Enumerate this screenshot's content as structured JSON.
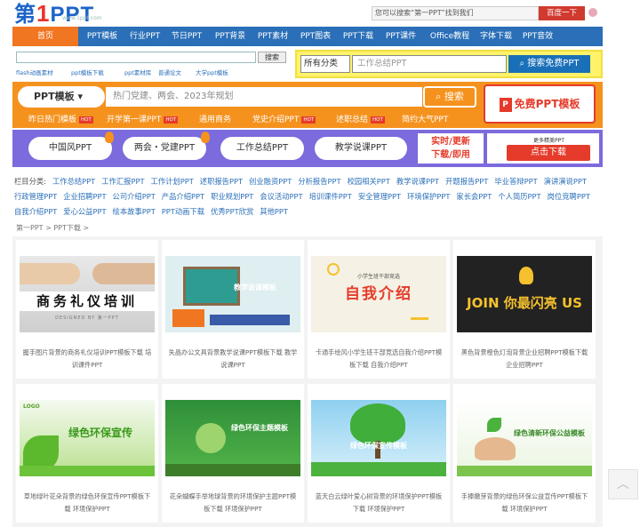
{
  "header": {
    "logo_text_a": "第",
    "logo_text_one": "1",
    "logo_text_b": "PPT",
    "logo_url": "www.1ppt.com",
    "search_placeholder": "您可以搜索“第一PPT”找到我们",
    "search_button": "百度一下"
  },
  "nav": {
    "items": [
      "首页",
      "PPT模板",
      "行业PPT",
      "节日PPT",
      "PPT背景",
      "PPT素材",
      "PPT图表",
      "PPT下载",
      "PPT课件",
      "Office教程",
      "字体下载",
      "PPT音效"
    ]
  },
  "strip": {
    "left_button": "搜索",
    "tags": [
      "flash动画素材",
      "ppt模板下载",
      "ppt素材库",
      "普通论文",
      "大学ppt模板"
    ],
    "category": "所有分类",
    "placeholder": "工作总结PPT",
    "button": "搜索免费PPT"
  },
  "orange": {
    "category": "PPT模板",
    "placeholder": "热门党建、两会、2023年规划",
    "search_button": "搜索",
    "free_button": "免费PPT模板",
    "free_icon": "P",
    "hot_label": "HOT",
    "links": [
      {
        "label": "昨日热门模板",
        "hot": true
      },
      {
        "label": "开学第一课PPT",
        "hot": true
      },
      {
        "label": "通用商务",
        "hot": false
      },
      {
        "label": "党史介绍PPT",
        "hot": true
      },
      {
        "label": "述职总结",
        "hot": true
      },
      {
        "label": "简约大气PPT",
        "hot": false
      }
    ]
  },
  "banner": {
    "pills": [
      "中国风PPT",
      "两会・党建PPT",
      "工作总结PPT",
      "教学说课PPT"
    ],
    "real_line1": "实时/更新",
    "real_line2": "下载/即用",
    "more": "更多精美PPT",
    "click": "点击下载"
  },
  "categories": {
    "label": "栏目分类:",
    "rows": [
      [
        "工作总结PPT",
        "工作汇报PPT",
        "工作计划PPT",
        "述职报告PPT",
        "创业融资PPT",
        "分析报告PPT",
        "校园相关PPT",
        "教学说课PPT",
        "开题报告PPT",
        "毕业答辩PPT",
        "演讲演说PPT"
      ],
      [
        "行政管理PPT",
        "企业招聘PPT",
        "公司介绍PPT",
        "产品介绍PPT",
        "职业规划PPT",
        "会议活动PPT",
        "培训课件PPT",
        "安全管理PPT",
        "环境保护PPT",
        "家长会PPT",
        "个人简历PPT",
        "岗位竞聘PPT"
      ],
      [
        "自我介绍PPT",
        "爱心公益PPT",
        "绘本故事PPT",
        "PPT动画下载",
        "优秀PPT欣赏",
        "其他PPT"
      ]
    ]
  },
  "breadcrumb": "第一PPT > PPT下载 >",
  "cards": [
    {
      "thumb_title": "商务礼仪培训",
      "thumb_sub": "DESIGNED BY 第一PPT",
      "caption": "握手图片背景的商务礼仪培训PPT模板下载 培训课件PPT"
    },
    {
      "thumb_title": "教学说课模板",
      "thumb_sub": "",
      "caption": "失晶办公文具背景教学说课PPT模板下载 教学说课PPT"
    },
    {
      "thumb_title": "自我介绍",
      "thumb_sub": "小学生班干部竞选",
      "caption": "卡通手绘风小学生班干部竞选自我介绍PPT模板下载 自我介绍PPT"
    },
    {
      "thumb_title": "JOIN 你最闪亮 US",
      "thumb_sub": "",
      "caption": "黑色背景橙色灯泡背景企业招聘PPT模板下载 企业招聘PPT"
    },
    {
      "thumb_title": "绿色环保宣传",
      "thumb_sub": "LOGO",
      "caption": "草地绿叶花朵背景的绿色环保宣传PPT模板下载 环境保护PPT"
    },
    {
      "thumb_title": "绿色环保主题模板",
      "thumb_sub": "",
      "caption": "花朵蝴蝶手举地球背景的环境保护主题PPT模板下载 环境保护PPT"
    },
    {
      "thumb_title": "绿色环保宣传模板",
      "thumb_sub": "",
      "caption": "蓝天白云绿叶爱心树背景的环境保护PPT模板下载 环境保护PPT"
    },
    {
      "thumb_title": "绿色清新环保公益模板",
      "thumb_sub": "",
      "caption": "手捧嫩芽背景的绿色环保公益宣传PPT模板下载 环境保护PPT"
    }
  ],
  "back_to_top": "︿",
  "colors": {
    "nav_blue": "#2a6fb8",
    "accent_orange": "#f5921e",
    "red": "#e53b2a",
    "banner_purple": "#7b6bdd"
  }
}
